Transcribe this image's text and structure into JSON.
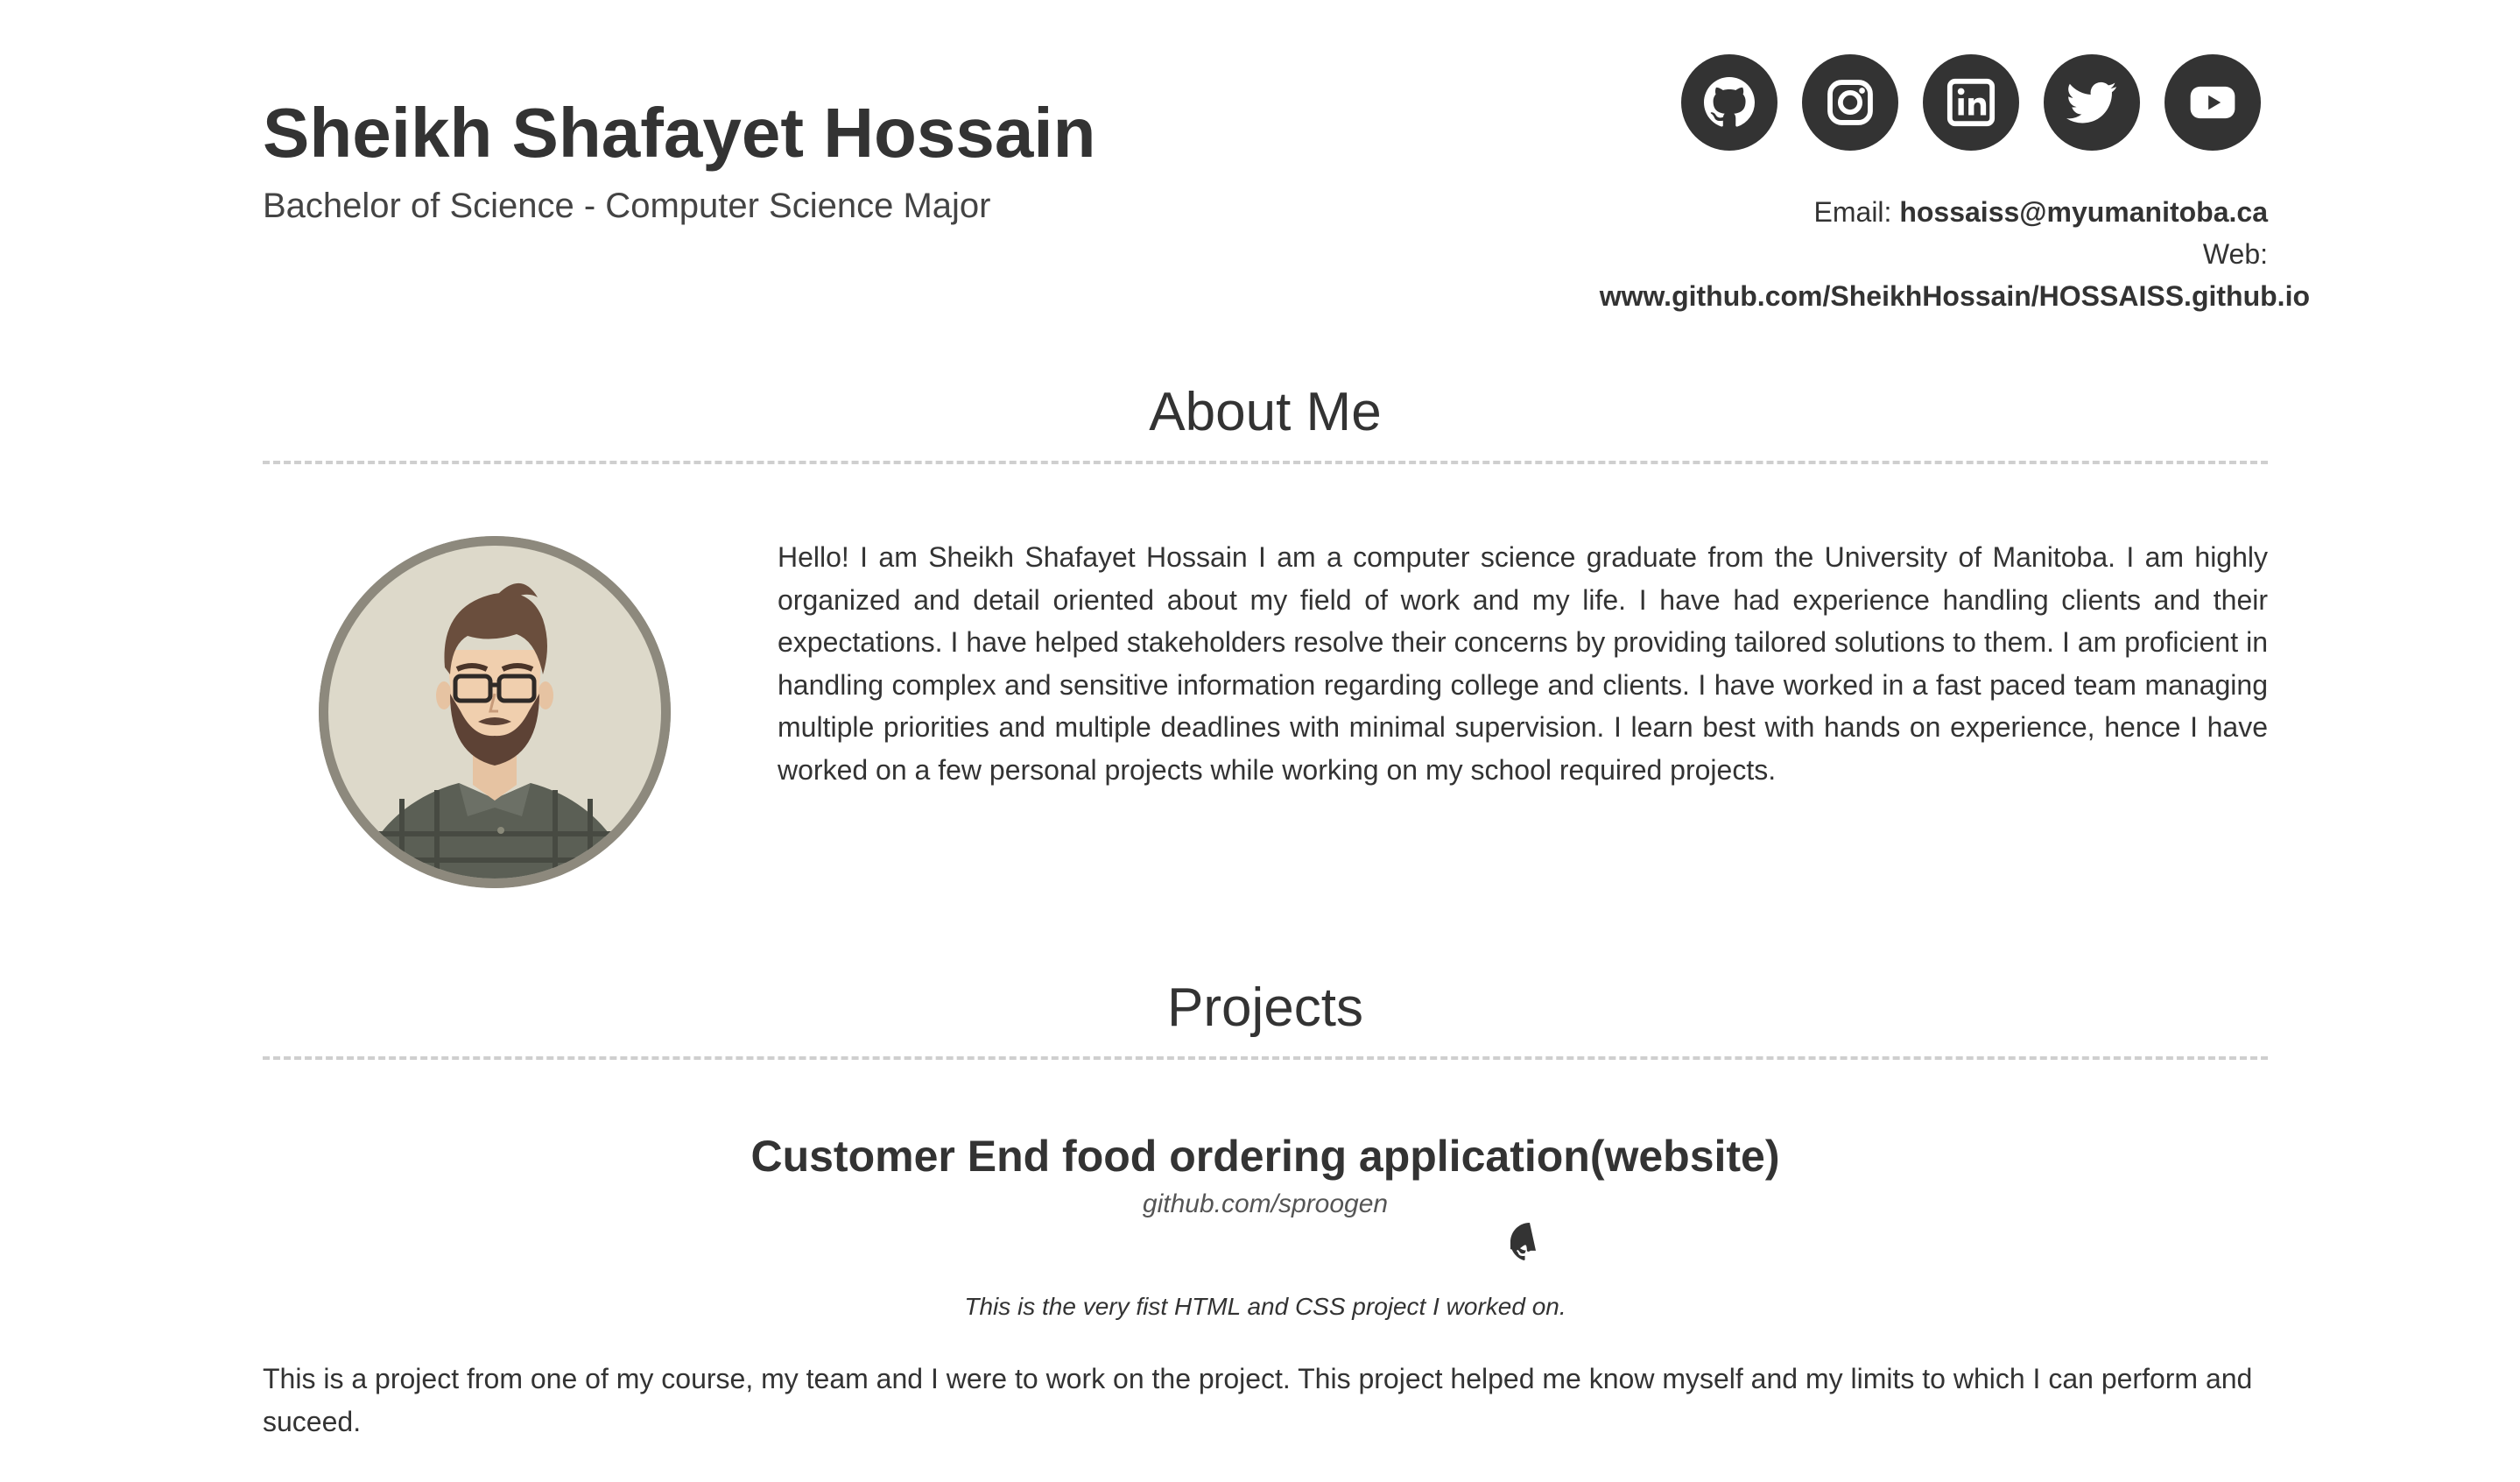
{
  "header": {
    "name": "Sheikh Shafayet Hossain",
    "degree": "Bachelor of Science - Computer Science Major",
    "email_label": "Email:",
    "email": "hossaiss@myumanitoba.ca",
    "web_label": "Web:",
    "web": "www.github.com/SheikhHossain/HOSSAISS.github.io"
  },
  "socials": [
    {
      "icon": "github-icon",
      "label": "GitHub"
    },
    {
      "icon": "instagram-icon",
      "label": "Instagram"
    },
    {
      "icon": "linkedin-icon",
      "label": "LinkedIn"
    },
    {
      "icon": "twitter-icon",
      "label": "Twitter"
    },
    {
      "icon": "youtube-icon",
      "label": "YouTube"
    }
  ],
  "about": {
    "title": "About Me",
    "text": "Hello! I am Sheikh Shafayet Hossain I am a computer science graduate from the University of Manitoba. I am highly organized and detail oriented about my field of work and my life. I have had experience handling clients and their expectations. I have helped stakeholders resolve their concerns by providing tailored solutions to them. I am proficient in handling complex and sensitive information regarding college and clients. I have worked in a fast paced team managing multiple priorities and multiple deadlines with minimal supervision. I learn best with hands on experience, hence I have worked on a few personal projects while working on my school required projects."
  },
  "projects": {
    "title": "Projects",
    "items": [
      {
        "name": "Customer End food ordering application(website)",
        "link": "github.com/sproogen",
        "tagline": "This is the very fist HTML and CSS project I worked on.",
        "description": "This is a project from one of my course, my team and I were to work on the project. This project helped me know myself and my limits to which I can perform and suceed."
      }
    ]
  },
  "colors": {
    "text": "#333333",
    "icon_bg": "#333333",
    "rule": "#cfcfcf"
  }
}
